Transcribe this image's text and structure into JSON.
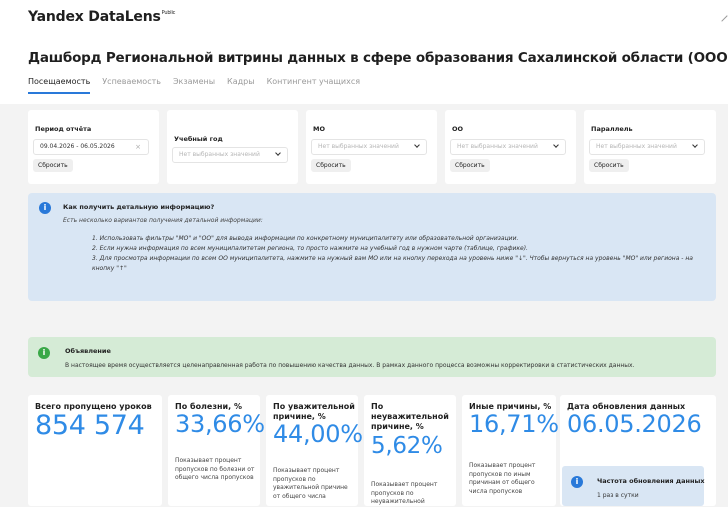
{
  "app": {
    "brand": "Yandex DataLens",
    "badge": "Public"
  },
  "dashboard": {
    "title": "Дашборд Региональной витрины данных в сфере образования Сахалинской области (ООО)",
    "tabs": [
      {
        "label": "Посещаемость",
        "active": true
      },
      {
        "label": "Успеваемость",
        "active": false
      },
      {
        "label": "Экзамены",
        "active": false
      },
      {
        "label": "Кадры",
        "active": false
      },
      {
        "label": "Контингент учащихся",
        "active": false
      }
    ]
  },
  "filters": {
    "period": {
      "label": "Период отчёта",
      "value": "09.04.2026 - 06.05.2026",
      "clear": "×",
      "reset": "Сбросить"
    },
    "year": {
      "label": "Учебный год",
      "placeholder": "Нет выбранных значений"
    },
    "mo": {
      "label": "МО",
      "placeholder": "Нет выбранных значений",
      "reset": "Сбросить"
    },
    "oo": {
      "label": "ОО",
      "placeholder": "Нет выбранных значений",
      "reset": "Сбросить"
    },
    "grade": {
      "label": "Параллель",
      "placeholder": "Нет выбранных значений",
      "reset": "Сбросить"
    }
  },
  "info": {
    "icon": "i",
    "title": "Как получить детальную информацию?",
    "subtitle": "Есть несколько вариантов получения детальной информации:",
    "items": [
      "1. Использовать фильтры \"МО\" и \"ОО\" для вывода информации по конкретному муниципалитету или образовательной организации.",
      "2. Если нужна информация по всем муниципалитетам региона, то просто нажмите на учебный год в нужном чарте (таблице, графике).",
      "3. Для просмотра информации по всем ОО муниципалитета, нажмите на нужный вам МО или на кнопку перехода на уровень ниже \"↓\". Чтобы вернуться на уровень \"МО\" или региона - на кнопку \"↑\""
    ]
  },
  "notice": {
    "icon": "i",
    "title": "Объявление",
    "text": "В настоящее время осуществляется целенаправленная работа по повышению качества данных. В рамках данного процесса возможны корректировки в статистических данных."
  },
  "kpis": {
    "total": {
      "title": "Всего пропущено уроков",
      "value": "854 574"
    },
    "illness": {
      "title": "По болезни, %",
      "value": "33,66%",
      "desc": "Показывает процент пропусков по болезни от общего числа пропусков"
    },
    "valid": {
      "title": "По уважительной причине, %",
      "value": "44,00%",
      "desc": "Показывает процент пропусков по уважительной причине от общего числа"
    },
    "invalid": {
      "title": "По неуважительной причине, %",
      "value": "5,62%",
      "desc": "Показывает процент пропусков по неуважительной"
    },
    "other": {
      "title": "Иные причины, %",
      "value": "16,71%",
      "desc": "Показывает процент пропусков по иным причинам от общего числа пропусков"
    },
    "updated": {
      "title": "Дата обновления данных",
      "value": "06.05.2026",
      "freq_title": "Частота обновления данных",
      "freq_value": "1 раз в сутки"
    }
  },
  "colors": {
    "accent": "#2979d9",
    "kpi_value": "#2f8be6",
    "info_bg": "#d9e6f4",
    "notice_bg": "#d5ebd6",
    "notice_icon": "#3aa848"
  }
}
